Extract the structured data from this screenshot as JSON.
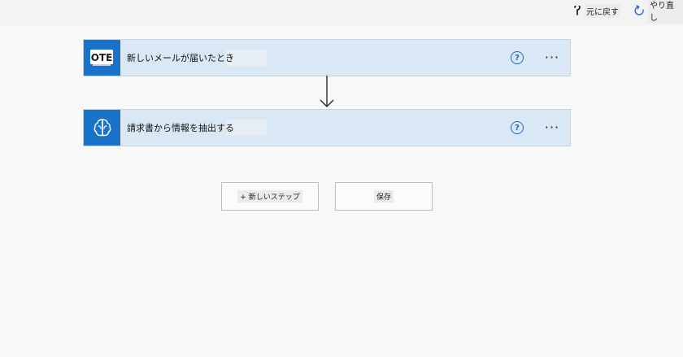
{
  "toolbar": {
    "undo_label": "元に戻す",
    "redo_label": "やり直し",
    "undo_icon": "undo-icon",
    "redo_icon": "redo-icon"
  },
  "steps": [
    {
      "title": "新しいメールが届いたとき",
      "icon": "outlook-icon",
      "icon_text": "OTE",
      "help_glyph": "?",
      "more_glyph": "···"
    },
    {
      "title": "請求書から情報を抽出する",
      "icon": "ai-brain-icon",
      "help_glyph": "?",
      "more_glyph": "···"
    }
  ],
  "actions": {
    "new_step_label": "+ 新しいステップ",
    "save_label": "保存"
  },
  "colors": {
    "accent": "#1a73c8",
    "card_bg": "#dae8f6",
    "link_blue": "#1e66c9"
  }
}
